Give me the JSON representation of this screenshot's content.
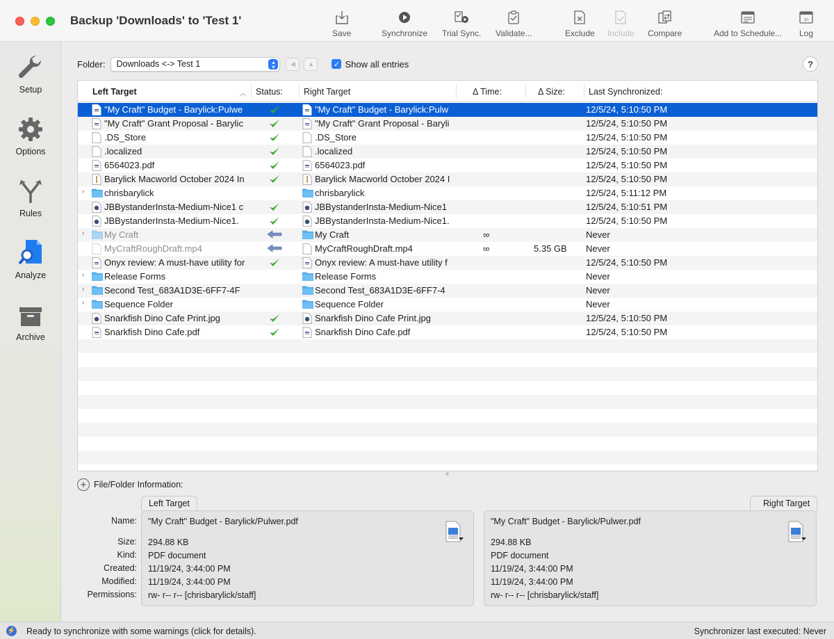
{
  "window": {
    "title": "Backup 'Downloads' to 'Test 1'"
  },
  "toolbar": [
    {
      "name": "save",
      "label": "Save",
      "icon": "save-icon",
      "enabled": true
    },
    {
      "name": "synchronize",
      "label": "Synchronize",
      "icon": "play-icon",
      "enabled": true
    },
    {
      "name": "trial-sync",
      "label": "Trial Sync.",
      "icon": "trial-sync-icon",
      "enabled": true
    },
    {
      "name": "validate",
      "label": "Validate...",
      "icon": "validate-icon",
      "enabled": true
    },
    {
      "name": "exclude",
      "label": "Exclude",
      "icon": "exclude-icon",
      "enabled": true
    },
    {
      "name": "include",
      "label": "Include",
      "icon": "include-icon",
      "enabled": false
    },
    {
      "name": "compare",
      "label": "Compare",
      "icon": "compare-icon",
      "enabled": true
    },
    {
      "name": "add-to-schedule",
      "label": "Add to Schedule...",
      "icon": "calendar-icon",
      "enabled": true
    },
    {
      "name": "log",
      "label": "Log",
      "icon": "log-icon",
      "enabled": true
    }
  ],
  "sidebar": [
    {
      "name": "setup",
      "label": "Setup",
      "icon": "wrench-icon"
    },
    {
      "name": "options",
      "label": "Options",
      "icon": "gear-icon"
    },
    {
      "name": "rules",
      "label": "Rules",
      "icon": "rules-fork-icon"
    },
    {
      "name": "analyze",
      "label": "Analyze",
      "icon": "analyze-magnifier-icon",
      "active": true
    },
    {
      "name": "archive",
      "label": "Archive",
      "icon": "archive-box-icon"
    }
  ],
  "folder": {
    "label": "Folder:",
    "selected": "Downloads <-> Test 1",
    "show_all_label": "Show all entries",
    "show_all_checked": true,
    "help": "?"
  },
  "table": {
    "columns": {
      "left": "Left Target",
      "status": "Status:",
      "right": "Right Target",
      "dtime": "Δ Time:",
      "dsize": "Δ Size:",
      "last": "Last Synchronized:"
    },
    "rows": [
      {
        "left": "\"My Craft\" Budget - Barylick:Pulwe",
        "right": "\"My Craft\" Budget - Barylick:Pulw",
        "status": "check",
        "dtime": "",
        "dsize": "",
        "last": "12/5/24, 5:10:50 PM",
        "type": "pdf",
        "folder": false,
        "selected": true
      },
      {
        "left": "\"My Craft\" Grant Proposal - Barylic",
        "right": "\"My Craft\" Grant Proposal - Baryli",
        "status": "check",
        "dtime": "",
        "dsize": "",
        "last": "12/5/24, 5:10:50 PM",
        "type": "doc",
        "folder": false
      },
      {
        "left": ".DS_Store",
        "right": ".DS_Store",
        "status": "check",
        "dtime": "",
        "dsize": "",
        "last": "12/5/24, 5:10:50 PM",
        "type": "blank",
        "folder": false
      },
      {
        "left": ".localized",
        "right": ".localized",
        "status": "check",
        "dtime": "",
        "dsize": "",
        "last": "12/5/24, 5:10:50 PM",
        "type": "blank",
        "folder": false
      },
      {
        "left": "6564023.pdf",
        "right": "6564023.pdf",
        "status": "check",
        "dtime": "",
        "dsize": "",
        "last": "12/5/24, 5:10:50 PM",
        "type": "pdf",
        "folder": false
      },
      {
        "left": "Barylick Macworld October 2024 In",
        "right": "Barylick Macworld October 2024 I",
        "status": "check",
        "dtime": "",
        "dsize": "",
        "last": "12/5/24, 5:10:50 PM",
        "type": "zip",
        "folder": false
      },
      {
        "left": "chrisbarylick",
        "right": "chrisbarylick",
        "status": "",
        "dtime": "",
        "dsize": "",
        "last": "12/5/24, 5:11:12 PM",
        "type": "folder",
        "folder": true
      },
      {
        "left": "JBBystanderInsta-Medium-Nice1 c",
        "right": "JBBystanderInsta-Medium-Nice1",
        "status": "check",
        "dtime": "",
        "dsize": "",
        "last": "12/5/24, 5:10:51 PM",
        "type": "image",
        "folder": false
      },
      {
        "left": "JBBystanderInsta-Medium-Nice1.",
        "right": "JBBystanderInsta-Medium-Nice1.",
        "status": "check",
        "dtime": "",
        "dsize": "",
        "last": "12/5/24, 5:10:50 PM",
        "type": "image",
        "folder": false
      },
      {
        "left": "My Craft",
        "right": "My Craft",
        "status": "arrow",
        "dtime": "∞",
        "dsize": "",
        "last": "Never",
        "type": "folder",
        "folder": true,
        "left_missing": true
      },
      {
        "left": "MyCraftRoughDraft.mp4",
        "right": "MyCraftRoughDraft.mp4",
        "status": "arrow",
        "dtime": "∞",
        "dsize": "5.35 GB",
        "last": "Never",
        "type": "video",
        "folder": false,
        "left_missing": true
      },
      {
        "left": "Onyx review: A must-have utility for",
        "right": "Onyx review: A must-have utility f",
        "status": "check",
        "dtime": "",
        "dsize": "",
        "last": "12/5/24, 5:10:50 PM",
        "type": "doc",
        "folder": false
      },
      {
        "left": "Release Forms",
        "right": "Release Forms",
        "status": "",
        "dtime": "",
        "dsize": "",
        "last": "Never",
        "type": "folder",
        "folder": true
      },
      {
        "left": "Second Test_683A1D3E-6FF7-4F",
        "right": "Second Test_683A1D3E-6FF7-4",
        "status": "",
        "dtime": "",
        "dsize": "",
        "last": "Never",
        "type": "folder",
        "folder": true
      },
      {
        "left": "Sequence Folder",
        "right": "Sequence Folder",
        "status": "",
        "dtime": "",
        "dsize": "",
        "last": "Never",
        "type": "folder",
        "folder": true
      },
      {
        "left": "Snarkfish Dino Cafe Print.jpg",
        "right": "Snarkfish Dino Cafe Print.jpg",
        "status": "check",
        "dtime": "",
        "dsize": "",
        "last": "12/5/24, 5:10:50 PM",
        "type": "image",
        "folder": false
      },
      {
        "left": "Snarkfish Dino Cafe.pdf",
        "right": "Snarkfish Dino Cafe.pdf",
        "status": "check",
        "dtime": "",
        "dsize": "",
        "last": "12/5/24, 5:10:50 PM",
        "type": "pdf",
        "folder": false
      }
    ]
  },
  "info": {
    "header": "File/Folder Information:",
    "labels": {
      "name": "Name:",
      "size": "Size:",
      "kind": "Kind:",
      "created": "Created:",
      "modified": "Modified:",
      "permissions": "Permissions:"
    },
    "left": {
      "tab": "Left Target",
      "name": "\"My Craft\" Budget - Barylick/Pulwer.pdf",
      "size": "294.88 KB",
      "kind": "PDF document",
      "created": "11/19/24, 3:44:00 PM",
      "modified": "11/19/24, 3:44:00 PM",
      "permissions": "rw- r-- r--    [chrisbarylick/staff]"
    },
    "right": {
      "tab": "Right Target",
      "name": "\"My Craft\" Budget - Barylick/Pulwer.pdf",
      "size": "294.88 KB",
      "kind": "PDF document",
      "created": "11/19/24, 3:44:00 PM",
      "modified": "11/19/24, 3:44:00 PM",
      "permissions": "rw- r-- r--    [chrisbarylick/staff]"
    }
  },
  "status": {
    "message": "Ready to synchronize with some warnings (click for details).",
    "right": "Synchronizer last executed:  Never"
  },
  "colors": {
    "accent": "#2c7cf6",
    "selection": "#0a5fd4",
    "check": "#3ca934",
    "arrow": "#7b90c4",
    "folder": "#5bb4f0"
  }
}
